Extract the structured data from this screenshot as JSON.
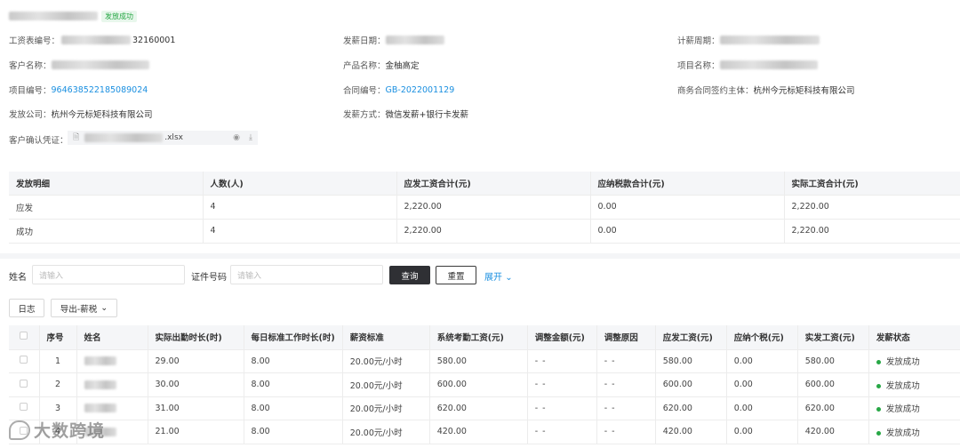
{
  "header": {
    "status_badge": "发放成功"
  },
  "info": {
    "payroll_no_label": "工资表编号：",
    "payroll_no_suffix": "32160001",
    "pay_date_label": "发薪日期：",
    "pay_period_label": "计薪周期：",
    "customer_label": "客户名称：",
    "product_label": "产品名称：",
    "product_value": "金柚高定",
    "project_name_label": "项目名称：",
    "project_no_label": "项目编号：",
    "project_no_value": "964638522185089024",
    "contract_no_label": "合同编号：",
    "contract_no_value": "GB-2022001129",
    "signing_entity_label": "商务合同签约主体：",
    "signing_entity_value": "杭州今元标矩科技有限公司",
    "issuer_label": "发放公司：",
    "issuer_value": "杭州今元标矩科技有限公司",
    "pay_method_label": "发薪方式：",
    "pay_method_value": "微信发薪+银行卡发薪",
    "voucher_label": "客户确认凭证：",
    "voucher_file_ext": ".xlsx"
  },
  "summary_table": {
    "headers": [
      "发放明细",
      "人数(人)",
      "应发工资合计(元)",
      "应纳税款合计(元)",
      "实际工资合计(元)"
    ],
    "rows": [
      [
        "应发",
        "4",
        "2,220.00",
        "0.00",
        "2,220.00"
      ],
      [
        "成功",
        "4",
        "2,220.00",
        "0.00",
        "2,220.00"
      ]
    ]
  },
  "filters": {
    "name_label": "姓名",
    "name_placeholder": "请输入",
    "id_label": "证件号码",
    "id_placeholder": "请输入",
    "query_button": "查询",
    "reset_button": "重置",
    "expand_link": "展开"
  },
  "toolbar": {
    "log_button": "日志",
    "export_button": "导出-薪税"
  },
  "main_table": {
    "headers": [
      "序号",
      "姓名",
      "实际出勤时长(时)",
      "每日标准工作时长(时)",
      "薪资标准",
      "系统考勤工资(元)",
      "调整金额(元)",
      "调整原因",
      "应发工资(元)",
      "应纳个税(元)",
      "实发工资(元)",
      "发薪状态"
    ],
    "rows": [
      {
        "no": "1",
        "hours": "29.00",
        "std": "8.00",
        "rate": "20.00元/小时",
        "sys_pay": "580.00",
        "adj_amt": "- -",
        "adj_reason": "- -",
        "gross": "580.00",
        "tax": "0.00",
        "net": "580.00",
        "status": "发放成功"
      },
      {
        "no": "2",
        "hours": "30.00",
        "std": "8.00",
        "rate": "20.00元/小时",
        "sys_pay": "600.00",
        "adj_amt": "- -",
        "adj_reason": "- -",
        "gross": "600.00",
        "tax": "0.00",
        "net": "600.00",
        "status": "发放成功"
      },
      {
        "no": "3",
        "hours": "31.00",
        "std": "8.00",
        "rate": "20.00元/小时",
        "sys_pay": "620.00",
        "adj_amt": "- -",
        "adj_reason": "- -",
        "gross": "620.00",
        "tax": "0.00",
        "net": "620.00",
        "status": "发放成功"
      },
      {
        "no": "4",
        "hours": "21.00",
        "std": "8.00",
        "rate": "20.00元/小时",
        "sys_pay": "420.00",
        "adj_amt": "- -",
        "adj_reason": "- -",
        "gross": "420.00",
        "tax": "0.00",
        "net": "420.00",
        "status": "发放成功"
      }
    ]
  },
  "colors": {
    "accent_link": "#1a8fe0",
    "success_green": "#27a745",
    "dark_button": "#2f3034"
  },
  "watermark": {
    "text": "大数跨境"
  }
}
